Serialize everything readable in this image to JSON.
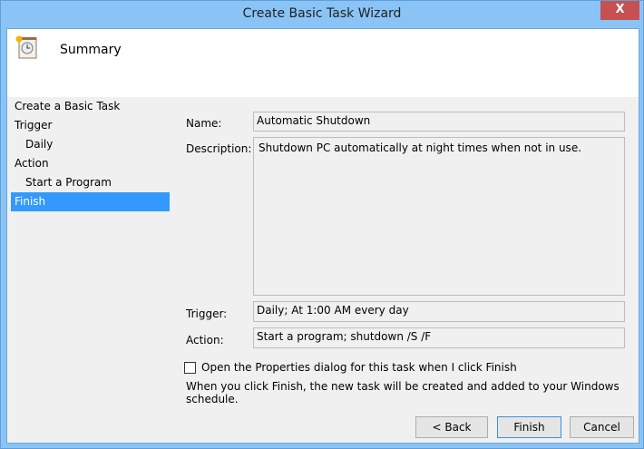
{
  "window": {
    "title": "Create Basic Task Wizard",
    "close_label": "X"
  },
  "header": {
    "title": "Summary"
  },
  "nav": {
    "items": [
      {
        "label": "Create a Basic Task"
      },
      {
        "label": "Trigger"
      },
      {
        "label": "Daily"
      },
      {
        "label": "Action"
      },
      {
        "label": "Start a Program"
      },
      {
        "label": "Finish"
      }
    ]
  },
  "summary": {
    "name_label": "Name:",
    "name": "Automatic Shutdown",
    "description_label": "Description:",
    "description": "Shutdown PC automatically at night times when not in use.",
    "trigger_label": "Trigger:",
    "trigger": "Daily; At 1:00 AM every day",
    "action_label": "Action:",
    "action": "Start a program; shutdown /S /F"
  },
  "open_properties": {
    "label": "Open the Properties dialog for this task when I click Finish",
    "checked": false
  },
  "note": "When you click Finish, the new task will be created and added to your Windows schedule.",
  "buttons": {
    "back": "< Back",
    "finish": "Finish",
    "cancel": "Cancel"
  }
}
